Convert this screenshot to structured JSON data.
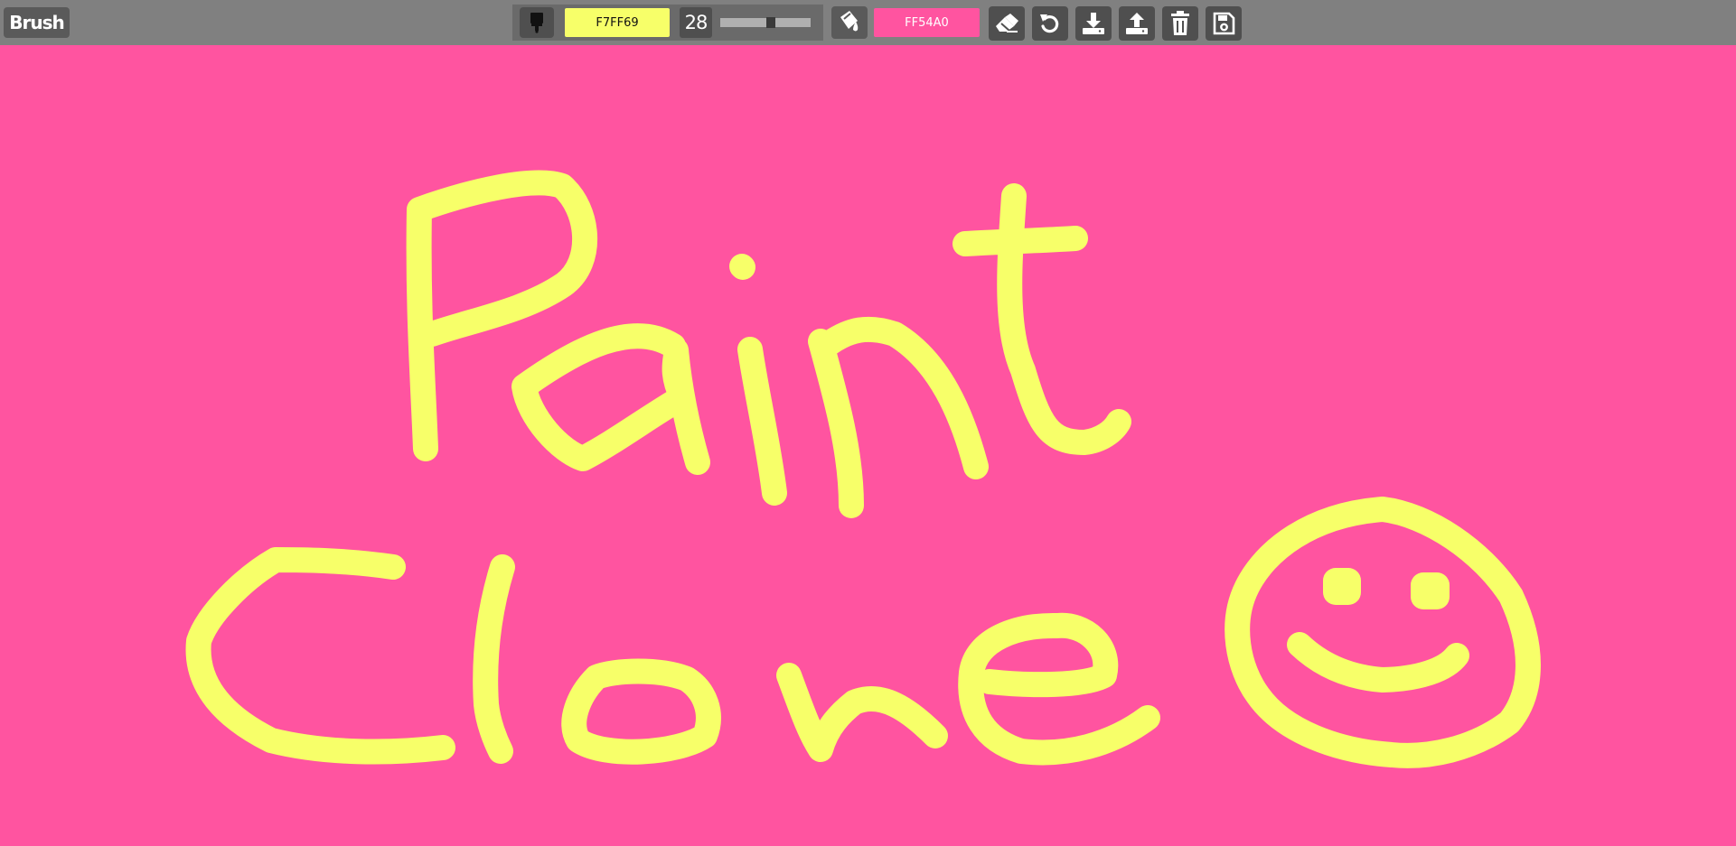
{
  "toolbar": {
    "mode_label": "Brush",
    "brush_color_hex": "F7FF69",
    "brush_size": "28",
    "brush_size_fraction": 0.56,
    "bucket_color_hex": "FF54A0",
    "icons": [
      "paintbrush-icon",
      "paint-bucket-icon",
      "eraser-icon",
      "undo-icon",
      "download-icon",
      "upload-icon",
      "trash-icon",
      "save-icon"
    ]
  },
  "canvas": {
    "background_color": "#FF54A0",
    "stroke_color": "#F7FF69"
  }
}
